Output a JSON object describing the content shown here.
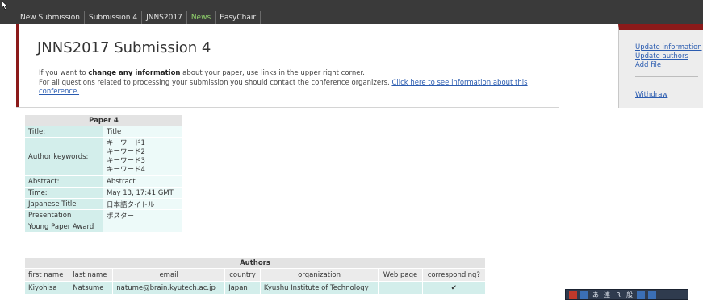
{
  "nav": {
    "items": [
      "New Submission",
      "Submission 4",
      "JNNS2017",
      "News",
      "EasyChair"
    ],
    "active": "News"
  },
  "header": {
    "title": "JNNS2017 Submission 4",
    "info_prefix": "If you want to ",
    "info_bold": "change any information",
    "info_suffix": " about your paper, use links in the upper right corner.",
    "questions_text": "For all questions related to processing your submission you should contact the conference organizers. ",
    "questions_link": "Click here to see information about this conference."
  },
  "side_menu": {
    "update_information": "Update information",
    "update_authors": "Update authors",
    "add_file": "Add file",
    "withdraw": "Withdraw"
  },
  "paper": {
    "caption": "Paper 4",
    "rows": [
      {
        "key": "Title:",
        "value": "Title"
      },
      {
        "key": "Author keywords:",
        "keywords": [
          "キーワード1",
          "キーワード2",
          "キーワード3",
          "キーワード4"
        ]
      },
      {
        "key": "Abstract:",
        "value": "Abstract"
      },
      {
        "key": "Time:",
        "value": "May 13, 17:41 GMT"
      },
      {
        "key": "Japanese Title",
        "value": "日本語タイトル"
      },
      {
        "key": "Presentation",
        "value": "ポスター"
      },
      {
        "key": "Young Paper Award",
        "value": ""
      }
    ]
  },
  "authors": {
    "caption": "Authors",
    "columns": [
      "first name",
      "last name",
      "email",
      "country",
      "organization",
      "Web page",
      "corresponding?"
    ],
    "rows": [
      [
        "Kiyohisa",
        "Natsume",
        "natume@brain.kyutech.ac.jp",
        "Japan",
        "Kyushu Institute of Technology",
        "",
        "✔"
      ]
    ]
  },
  "taskbar": {
    "icons": [
      "acrobat-icon",
      "ime-icon"
    ],
    "glyphs": [
      "あ",
      "連",
      "R",
      "般"
    ]
  },
  "colors": {
    "top_bar": "#3a3a3a",
    "accent_red": "#8b1a1a",
    "link_blue": "#2b5cb0",
    "active_nav_green": "#8fd16b",
    "table_key_bg": "#d3eeeb",
    "table_value_bg": "#edfaf9"
  }
}
